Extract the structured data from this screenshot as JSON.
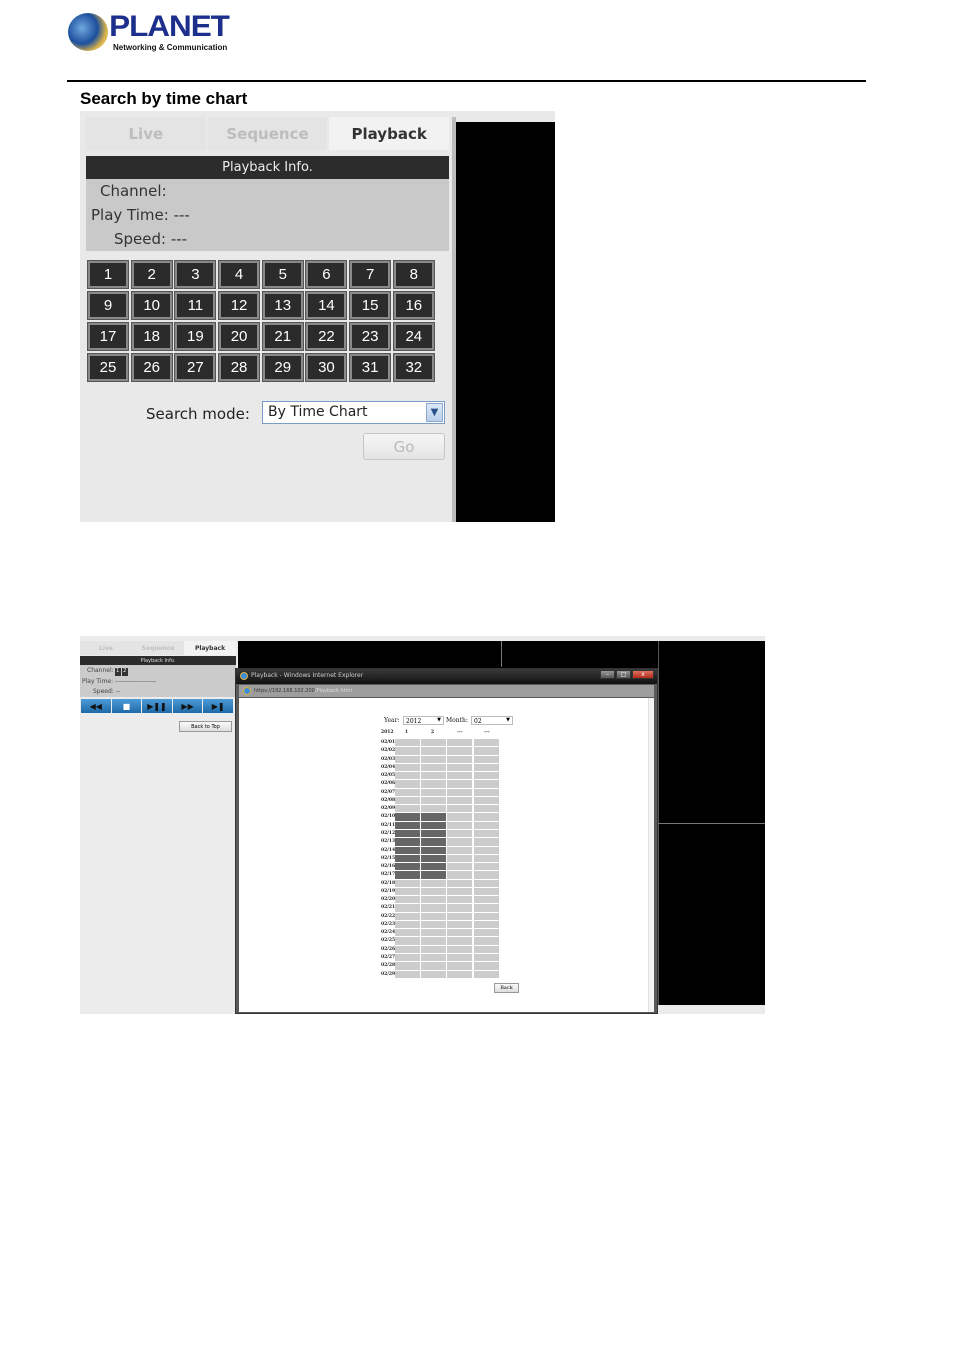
{
  "logo": {
    "name": "PLANET",
    "tagline": "Networking & Communication"
  },
  "heading": "Search by time chart",
  "screenshot1": {
    "tabs": [
      {
        "label": "Live",
        "active": false
      },
      {
        "label": "Sequence",
        "active": false
      },
      {
        "label": "Playback",
        "active": true
      }
    ],
    "info_title": "Playback Info.",
    "channel_label": "Channel:",
    "play_time": "Play Time: ---",
    "speed": "Speed: ---",
    "channels": [
      "1",
      "2",
      "3",
      "4",
      "5",
      "6",
      "7",
      "8",
      "9",
      "10",
      "11",
      "12",
      "13",
      "14",
      "15",
      "16",
      "17",
      "18",
      "19",
      "20",
      "21",
      "22",
      "23",
      "24",
      "25",
      "26",
      "27",
      "28",
      "29",
      "30",
      "31",
      "32"
    ],
    "search_mode_label": "Search mode:",
    "search_mode_value": "By Time Chart",
    "go_label": "Go"
  },
  "screenshot2": {
    "tabs": [
      {
        "label": "Live",
        "active": false
      },
      {
        "label": "Sequence",
        "active": false
      },
      {
        "label": "Playback",
        "active": true
      }
    ],
    "info_title": "Playback Info.",
    "channel_label": "Channel:",
    "channel_chips": [
      "1",
      "2"
    ],
    "play_time": "Play Time: -------------------",
    "speed": "Speed: --",
    "controls": [
      {
        "icon": "rewind-icon",
        "glyph": "◀◀"
      },
      {
        "icon": "stop-icon",
        "glyph": "■"
      },
      {
        "icon": "play-pause-icon",
        "glyph": "▶❚❚"
      },
      {
        "icon": "fast-forward-icon",
        "glyph": "▶▶"
      },
      {
        "icon": "step-end-icon",
        "glyph": "▶❚"
      }
    ],
    "back_to_top": "Back to Top",
    "popup": {
      "title": "Playback - Windows Internet Explorer",
      "url_host": "https://192.168.102.200",
      "url_path": "/Playback.html",
      "year_label": "Year:",
      "year_value": "2012",
      "month_label": "Month:",
      "month_value": "02",
      "back_label": "Back"
    }
  },
  "time_chart": {
    "corner": "2012",
    "columns": [
      "1",
      "2",
      "---",
      "---"
    ],
    "days": [
      "02/01",
      "02/02",
      "02/03",
      "02/04",
      "02/05",
      "02/06",
      "02/07",
      "02/08",
      "02/09",
      "02/10",
      "02/11",
      "02/12",
      "02/13",
      "02/14",
      "02/15",
      "02/16",
      "02/17",
      "02/18",
      "02/19",
      "02/20",
      "02/21",
      "02/22",
      "02/23",
      "02/24",
      "02/25",
      "02/26",
      "02/27",
      "02/28",
      "02/29"
    ],
    "recorded": {
      "1": [
        "02/10",
        "02/11",
        "02/12",
        "02/13",
        "02/14",
        "02/15",
        "02/16",
        "02/17"
      ],
      "2": [
        "02/10",
        "02/11",
        "02/12",
        "02/13",
        "02/14",
        "02/15",
        "02/16",
        "02/17"
      ]
    },
    "colors": {
      "recorded": "#666666",
      "empty": "#cccccc"
    }
  }
}
